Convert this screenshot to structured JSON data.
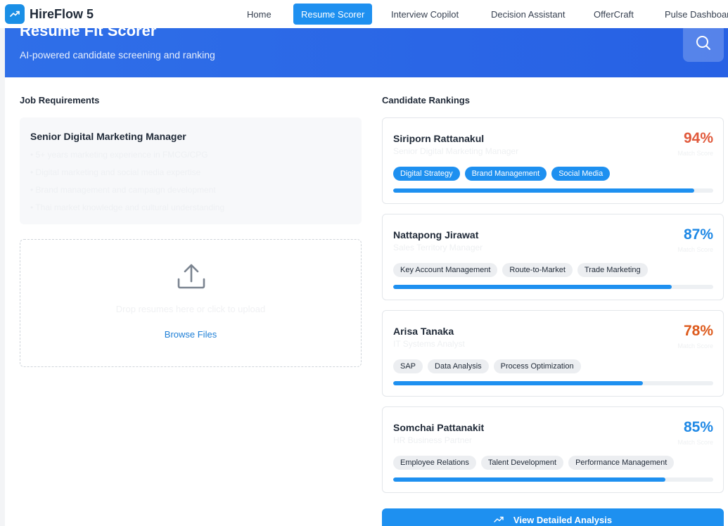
{
  "app": {
    "name": "HireFlow 5"
  },
  "nav": [
    {
      "label": "Home",
      "active": false
    },
    {
      "label": "Resume Scorer",
      "active": true
    },
    {
      "label": "Interview Copilot",
      "active": false
    },
    {
      "label": "Decision Assistant",
      "active": false
    },
    {
      "label": "OfferCraft",
      "active": false
    },
    {
      "label": "Pulse Dashboard",
      "active": false
    }
  ],
  "hero": {
    "title": "Resume Fit Scorer",
    "subtitle": "AI-powered candidate screening and ranking"
  },
  "job": {
    "section_title": "Job Requirements",
    "title": "Senior Digital Marketing Manager",
    "requirements": [
      "• 5+ years marketing experience in FMCG/CPG",
      "• Digital marketing and social media expertise",
      "• Brand management and campaign development",
      "• Thai market knowledge and cultural understanding"
    ]
  },
  "upload": {
    "drop_text": "Drop resumes here or click to upload",
    "browse_label": "Browse Files"
  },
  "rankings": {
    "section_title": "Candidate Rankings",
    "score_label": "Match Score",
    "candidates": [
      {
        "name": "Siriporn Rattanakul",
        "role": "Senior Digital Marketing Manager",
        "score": "94%",
        "score_value": 94,
        "score_color": "#e0583a",
        "tags_highlighted": true,
        "tags": [
          "Digital Strategy",
          "Brand Management",
          "Social Media"
        ]
      },
      {
        "name": "Nattapong Jirawat",
        "role": "Sales Territory Manager",
        "score": "87%",
        "score_value": 87,
        "score_color": "#1e88e5",
        "tags_highlighted": false,
        "tags": [
          "Key Account Management",
          "Route-to-Market",
          "Trade Marketing"
        ]
      },
      {
        "name": "Arisa Tanaka",
        "role": "IT Systems Analyst",
        "score": "78%",
        "score_value": 78,
        "score_color": "#dd5a1c",
        "tags_highlighted": false,
        "tags": [
          "SAP",
          "Data Analysis",
          "Process Optimization"
        ]
      },
      {
        "name": "Somchai Pattanakit",
        "role": "HR Business Partner",
        "score": "85%",
        "score_value": 85,
        "score_color": "#1e88e5",
        "tags_highlighted": false,
        "tags": [
          "Employee Relations",
          "Talent Development",
          "Performance Management"
        ]
      }
    ]
  },
  "cta": {
    "label": "View Detailed Analysis"
  },
  "colors": {
    "accent": "#1e90f0",
    "hero": "#2a66e6"
  }
}
